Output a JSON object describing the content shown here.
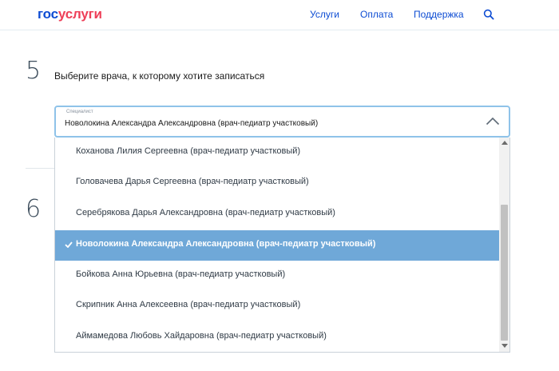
{
  "header": {
    "logo": {
      "part1": "гос",
      "part2": "услуги"
    },
    "nav": [
      "Услуги",
      "Оплата",
      "Поддержка"
    ],
    "search_icon": "search-icon"
  },
  "steps": [
    {
      "number": "5",
      "title": "Выберите врача, к которому хотите записаться"
    },
    {
      "number": "6"
    }
  ],
  "specialist_select": {
    "label": "Специалист",
    "value": "Новолокина Александра Александровна (врач-педиатр участковый)",
    "chevron_icon": "chevron-up-icon",
    "options": [
      {
        "label": "Коханова Лилия Сергеевна (врач-педиатр участковый)",
        "selected": false
      },
      {
        "label": "Головачева Дарья Сергеевна (врач-педиатр участковый)",
        "selected": false
      },
      {
        "label": "Серебрякова Дарья Александровна (врач-педиатр участковый)",
        "selected": false
      },
      {
        "label": "Новолокина Александра Александровна (врач-педиатр участковый)",
        "selected": true
      },
      {
        "label": "Бойкова Анна Юрьевна (врач-педиатр участковый)",
        "selected": false
      },
      {
        "label": "Скрипник Анна Алексеевна (врач-педиатр участковый)",
        "selected": false
      },
      {
        "label": "Аймамедова Любовь Хайдаровна (врач-педиатр участковый)",
        "selected": false
      }
    ]
  },
  "colors": {
    "brand_blue": "#0d4cd3",
    "brand_red": "#ee3f58",
    "selected_option_bg": "#6fa8d8",
    "focus_border": "#8fc3e9"
  }
}
